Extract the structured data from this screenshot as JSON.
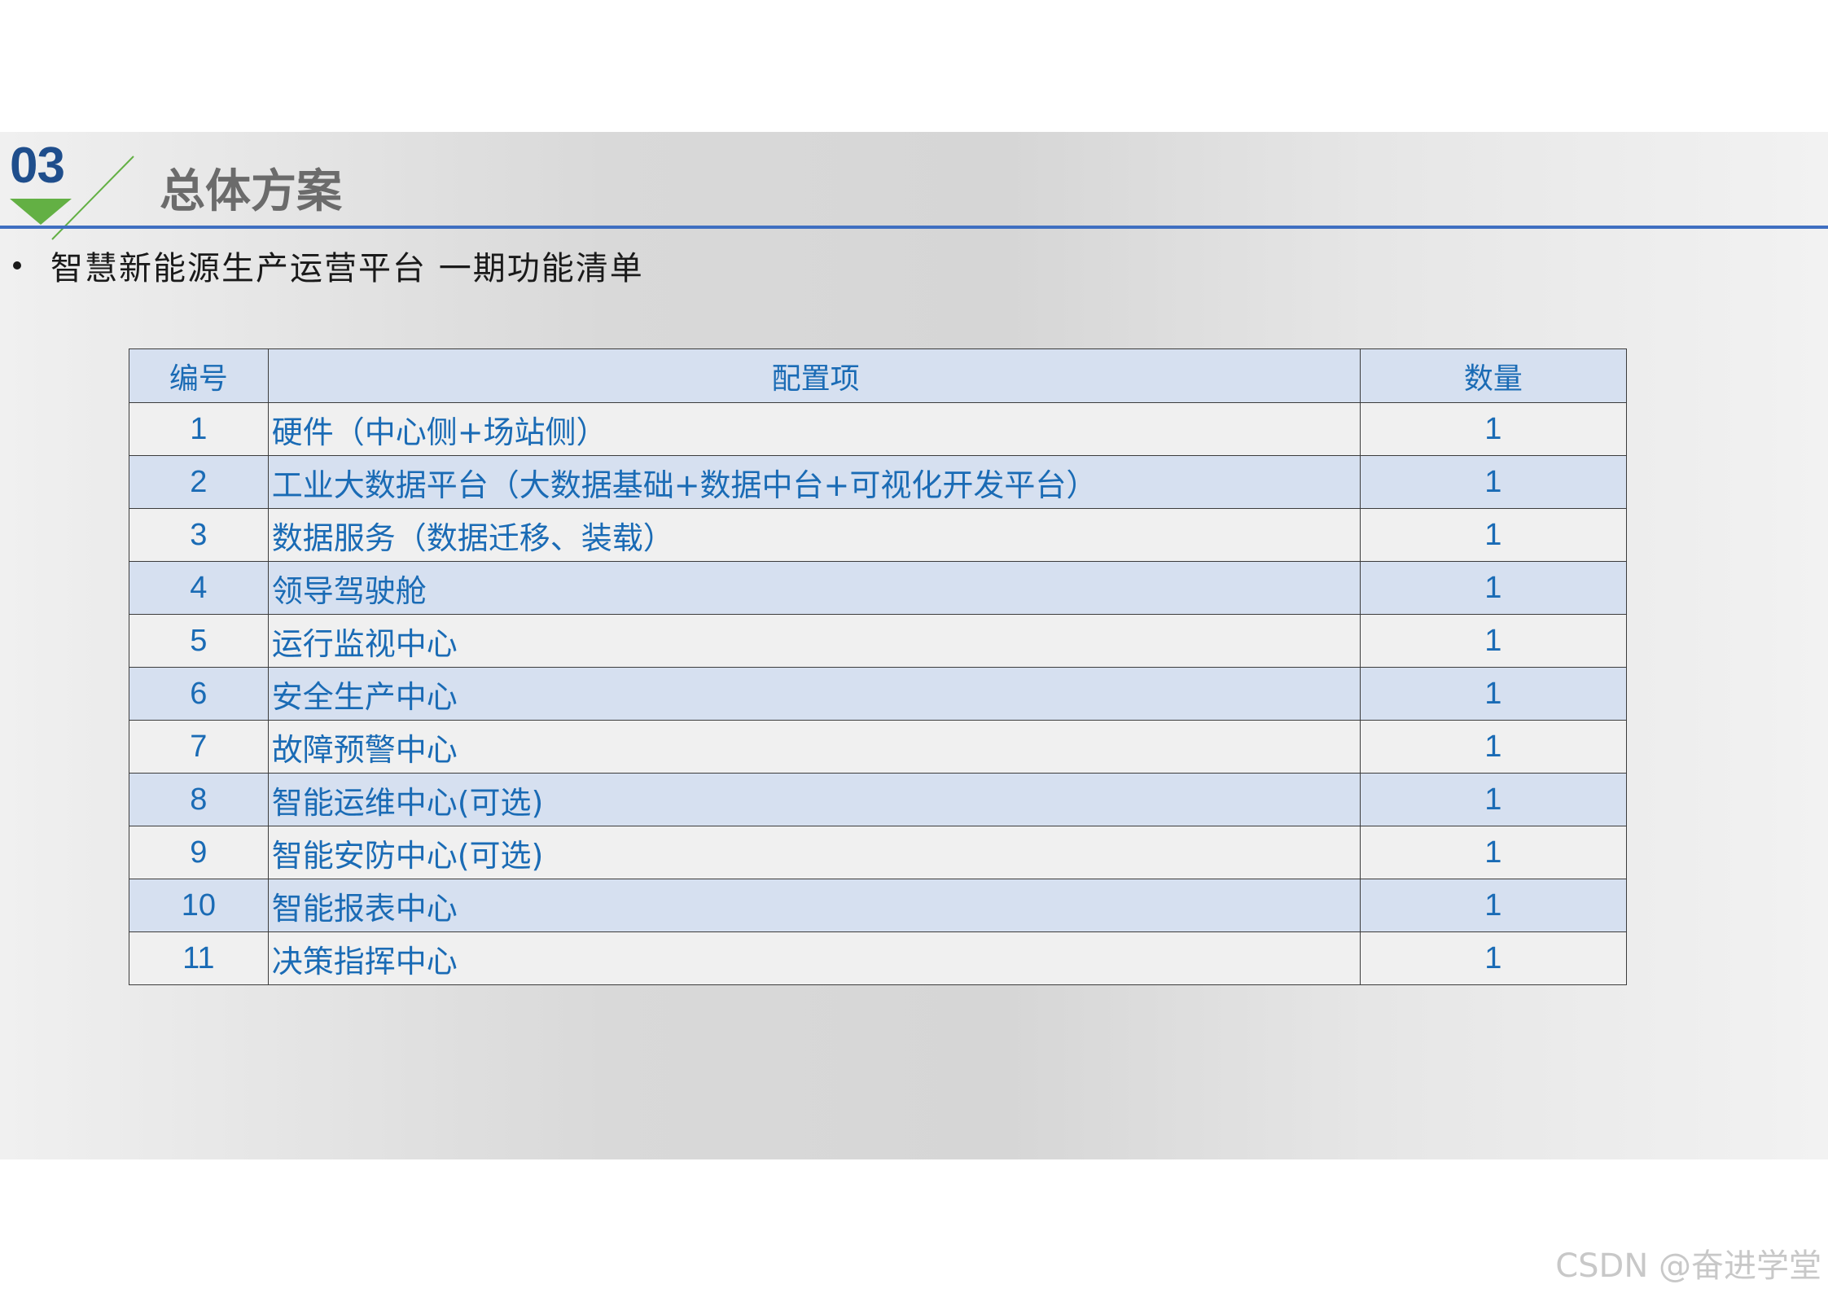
{
  "header": {
    "section_number": "03",
    "section_title": "总体方案",
    "colors": {
      "number": "#1f4e8c",
      "arrow": "#63b044",
      "rule": "#3f6fc1",
      "title": "#6b6b6b"
    }
  },
  "subtitle": "智慧新能源生产运营平台  一期功能清单",
  "table": {
    "headers": {
      "no": "编号",
      "item": "配置项",
      "qty": "数量"
    },
    "rows": [
      {
        "no": "1",
        "item": "硬件（中心侧+场站侧）",
        "qty": "1"
      },
      {
        "no": "2",
        "item": "工业大数据平台（大数据基础+数据中台+可视化开发平台）",
        "qty": "1"
      },
      {
        "no": "3",
        "item": "数据服务（数据迁移、装载）",
        "qty": "1"
      },
      {
        "no": "4",
        "item": "领导驾驶舱",
        "qty": "1"
      },
      {
        "no": "5",
        "item": "运行监视中心",
        "qty": "1"
      },
      {
        "no": "6",
        "item": "安全生产中心",
        "qty": "1"
      },
      {
        "no": "7",
        "item": "故障预警中心",
        "qty": "1"
      },
      {
        "no": "8",
        "item": "智能运维中心(可选)",
        "qty": "1"
      },
      {
        "no": "9",
        "item": "智能安防中心(可选)",
        "qty": "1"
      },
      {
        "no": "10",
        "item": "智能报表中心",
        "qty": "1"
      },
      {
        "no": "11",
        "item": "决策指挥中心",
        "qty": "1"
      }
    ],
    "colors": {
      "text": "#1a6bb5",
      "row_light": "#f0f0f0",
      "row_blue": "#d6e0f0"
    }
  },
  "watermark": "CSDN @奋进学堂"
}
